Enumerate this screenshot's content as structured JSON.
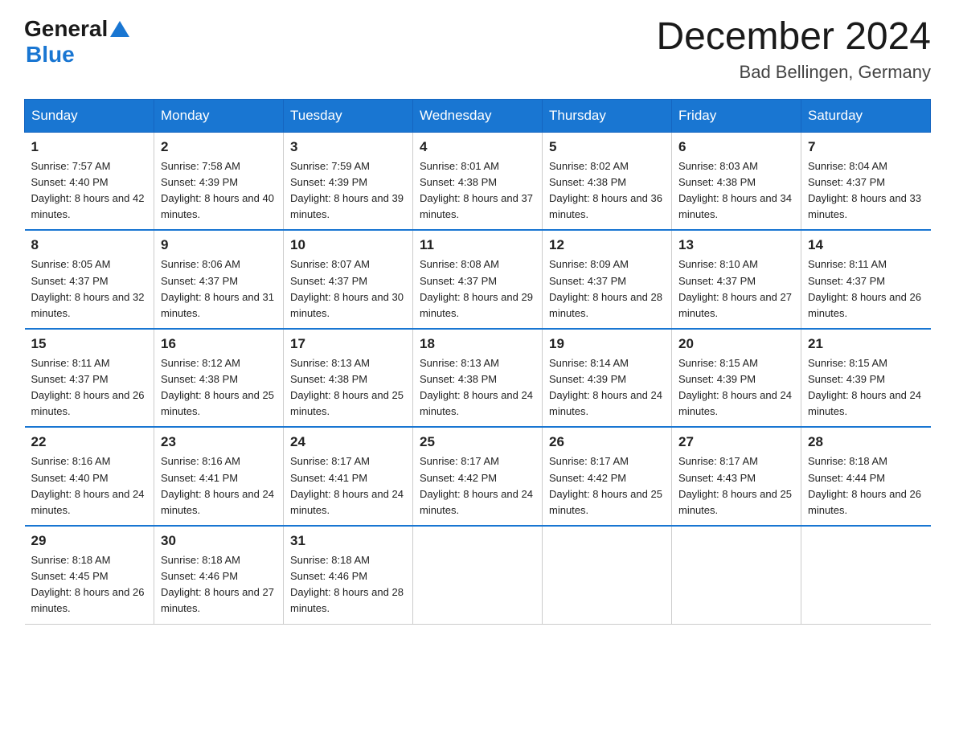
{
  "logo": {
    "general": "General",
    "blue": "Blue"
  },
  "title": {
    "month_year": "December 2024",
    "location": "Bad Bellingen, Germany"
  },
  "headers": [
    "Sunday",
    "Monday",
    "Tuesday",
    "Wednesday",
    "Thursday",
    "Friday",
    "Saturday"
  ],
  "weeks": [
    [
      {
        "day": "1",
        "sunrise": "7:57 AM",
        "sunset": "4:40 PM",
        "daylight": "8 hours and 42 minutes."
      },
      {
        "day": "2",
        "sunrise": "7:58 AM",
        "sunset": "4:39 PM",
        "daylight": "8 hours and 40 minutes."
      },
      {
        "day": "3",
        "sunrise": "7:59 AM",
        "sunset": "4:39 PM",
        "daylight": "8 hours and 39 minutes."
      },
      {
        "day": "4",
        "sunrise": "8:01 AM",
        "sunset": "4:38 PM",
        "daylight": "8 hours and 37 minutes."
      },
      {
        "day": "5",
        "sunrise": "8:02 AM",
        "sunset": "4:38 PM",
        "daylight": "8 hours and 36 minutes."
      },
      {
        "day": "6",
        "sunrise": "8:03 AM",
        "sunset": "4:38 PM",
        "daylight": "8 hours and 34 minutes."
      },
      {
        "day": "7",
        "sunrise": "8:04 AM",
        "sunset": "4:37 PM",
        "daylight": "8 hours and 33 minutes."
      }
    ],
    [
      {
        "day": "8",
        "sunrise": "8:05 AM",
        "sunset": "4:37 PM",
        "daylight": "8 hours and 32 minutes."
      },
      {
        "day": "9",
        "sunrise": "8:06 AM",
        "sunset": "4:37 PM",
        "daylight": "8 hours and 31 minutes."
      },
      {
        "day": "10",
        "sunrise": "8:07 AM",
        "sunset": "4:37 PM",
        "daylight": "8 hours and 30 minutes."
      },
      {
        "day": "11",
        "sunrise": "8:08 AM",
        "sunset": "4:37 PM",
        "daylight": "8 hours and 29 minutes."
      },
      {
        "day": "12",
        "sunrise": "8:09 AM",
        "sunset": "4:37 PM",
        "daylight": "8 hours and 28 minutes."
      },
      {
        "day": "13",
        "sunrise": "8:10 AM",
        "sunset": "4:37 PM",
        "daylight": "8 hours and 27 minutes."
      },
      {
        "day": "14",
        "sunrise": "8:11 AM",
        "sunset": "4:37 PM",
        "daylight": "8 hours and 26 minutes."
      }
    ],
    [
      {
        "day": "15",
        "sunrise": "8:11 AM",
        "sunset": "4:37 PM",
        "daylight": "8 hours and 26 minutes."
      },
      {
        "day": "16",
        "sunrise": "8:12 AM",
        "sunset": "4:38 PM",
        "daylight": "8 hours and 25 minutes."
      },
      {
        "day": "17",
        "sunrise": "8:13 AM",
        "sunset": "4:38 PM",
        "daylight": "8 hours and 25 minutes."
      },
      {
        "day": "18",
        "sunrise": "8:13 AM",
        "sunset": "4:38 PM",
        "daylight": "8 hours and 24 minutes."
      },
      {
        "day": "19",
        "sunrise": "8:14 AM",
        "sunset": "4:39 PM",
        "daylight": "8 hours and 24 minutes."
      },
      {
        "day": "20",
        "sunrise": "8:15 AM",
        "sunset": "4:39 PM",
        "daylight": "8 hours and 24 minutes."
      },
      {
        "day": "21",
        "sunrise": "8:15 AM",
        "sunset": "4:39 PM",
        "daylight": "8 hours and 24 minutes."
      }
    ],
    [
      {
        "day": "22",
        "sunrise": "8:16 AM",
        "sunset": "4:40 PM",
        "daylight": "8 hours and 24 minutes."
      },
      {
        "day": "23",
        "sunrise": "8:16 AM",
        "sunset": "4:41 PM",
        "daylight": "8 hours and 24 minutes."
      },
      {
        "day": "24",
        "sunrise": "8:17 AM",
        "sunset": "4:41 PM",
        "daylight": "8 hours and 24 minutes."
      },
      {
        "day": "25",
        "sunrise": "8:17 AM",
        "sunset": "4:42 PM",
        "daylight": "8 hours and 24 minutes."
      },
      {
        "day": "26",
        "sunrise": "8:17 AM",
        "sunset": "4:42 PM",
        "daylight": "8 hours and 25 minutes."
      },
      {
        "day": "27",
        "sunrise": "8:17 AM",
        "sunset": "4:43 PM",
        "daylight": "8 hours and 25 minutes."
      },
      {
        "day": "28",
        "sunrise": "8:18 AM",
        "sunset": "4:44 PM",
        "daylight": "8 hours and 26 minutes."
      }
    ],
    [
      {
        "day": "29",
        "sunrise": "8:18 AM",
        "sunset": "4:45 PM",
        "daylight": "8 hours and 26 minutes."
      },
      {
        "day": "30",
        "sunrise": "8:18 AM",
        "sunset": "4:46 PM",
        "daylight": "8 hours and 27 minutes."
      },
      {
        "day": "31",
        "sunrise": "8:18 AM",
        "sunset": "4:46 PM",
        "daylight": "8 hours and 28 minutes."
      },
      null,
      null,
      null,
      null
    ]
  ],
  "labels": {
    "sunrise": "Sunrise: ",
    "sunset": "Sunset: ",
    "daylight": "Daylight: "
  }
}
